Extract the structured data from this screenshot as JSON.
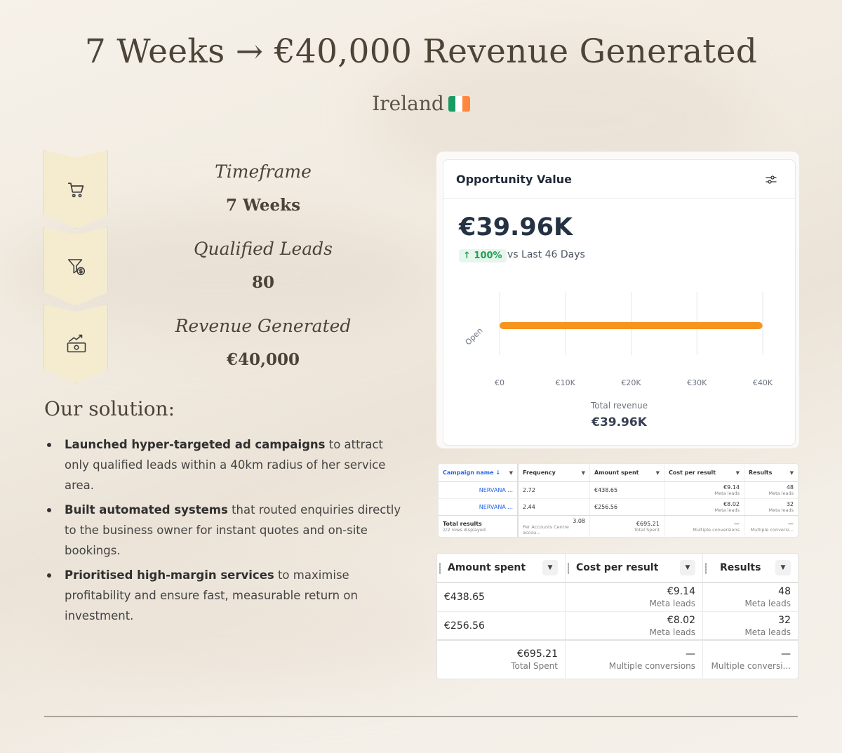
{
  "header": {
    "title": "7 Weeks → €40,000 Revenue Generated",
    "subtitle": "Ireland",
    "flag_colors": [
      "#169b62",
      "#ffffff",
      "#ff883e"
    ]
  },
  "stats": [
    {
      "icon": "cart-icon",
      "label": "Timeframe",
      "value": "7 Weeks"
    },
    {
      "icon": "funnel-dollar-icon",
      "label": "Qualified Leads",
      "value": "80"
    },
    {
      "icon": "money-growth-icon",
      "label": "Revenue Generated",
      "value": "€40,000"
    }
  ],
  "solution": {
    "title": "Our solution:",
    "bullets": [
      {
        "bold": "Launched hyper-targeted ad campaigns",
        "text": " to attract only qualified leads within a 40km radius of her service area."
      },
      {
        "bold": "Built automated systems",
        "text": " that routed enquiries directly to the business owner for instant quotes and on-site bookings."
      },
      {
        "bold": "Prioritised high-margin services",
        "text": " to maximise profitability and ensure fast, measurable return on investment."
      }
    ]
  },
  "opportunity": {
    "title": "Opportunity Value",
    "value": "€39.96K",
    "change": "↑ 100%",
    "comparison": "vs Last 46 Days",
    "total_label": "Total revenue",
    "total_value": "€39.96K"
  },
  "chart_data": {
    "type": "bar",
    "orientation": "horizontal",
    "categories": [
      "Open"
    ],
    "values": [
      39960
    ],
    "xlim": [
      0,
      40000
    ],
    "x_ticks": [
      "€0",
      "€10K",
      "€20K",
      "€30K",
      "€40K"
    ],
    "grid": true,
    "bar_color": "#f7941d"
  },
  "table_small": {
    "headers": [
      "Campaign name ↓",
      "Frequency",
      "Amount spent",
      "Cost per result",
      "Results"
    ],
    "rows": [
      {
        "name": "NERVANA ...",
        "frequency": "2.72",
        "amount": "€438.65",
        "cost": "€9.14",
        "cost_sub": "Meta leads",
        "results": "48",
        "results_sub": "Meta leads"
      },
      {
        "name": "NERVANA ...",
        "frequency": "2.44",
        "amount": "€256.56",
        "cost": "€8.02",
        "cost_sub": "Meta leads",
        "results": "32",
        "results_sub": "Meta leads"
      }
    ],
    "total": {
      "label": "Total results",
      "sub": "2/2 rows displayed",
      "frequency": "3.08",
      "frequency_sub": "Per Accounts Centre accou...",
      "amount": "€695.21",
      "amount_sub": "Total Spent",
      "cost": "—",
      "cost_sub": "Multiple conversions",
      "results": "—",
      "results_sub": "Multiple conversi..."
    }
  },
  "table_big": {
    "headers": [
      "Amount spent",
      "Cost per result",
      "Results"
    ],
    "rows": [
      {
        "amount": "€438.65",
        "cost": "€9.14",
        "cost_sub": "Meta leads",
        "results": "48",
        "results_sub": "Meta leads"
      },
      {
        "amount": "€256.56",
        "cost": "€8.02",
        "cost_sub": "Meta leads",
        "results": "32",
        "results_sub": "Meta leads"
      }
    ],
    "total": {
      "amount": "€695.21",
      "amount_sub": "Total Spent",
      "cost": "—",
      "cost_sub": "Multiple conversions",
      "results": "—",
      "results_sub": "Multiple conversi..."
    }
  }
}
